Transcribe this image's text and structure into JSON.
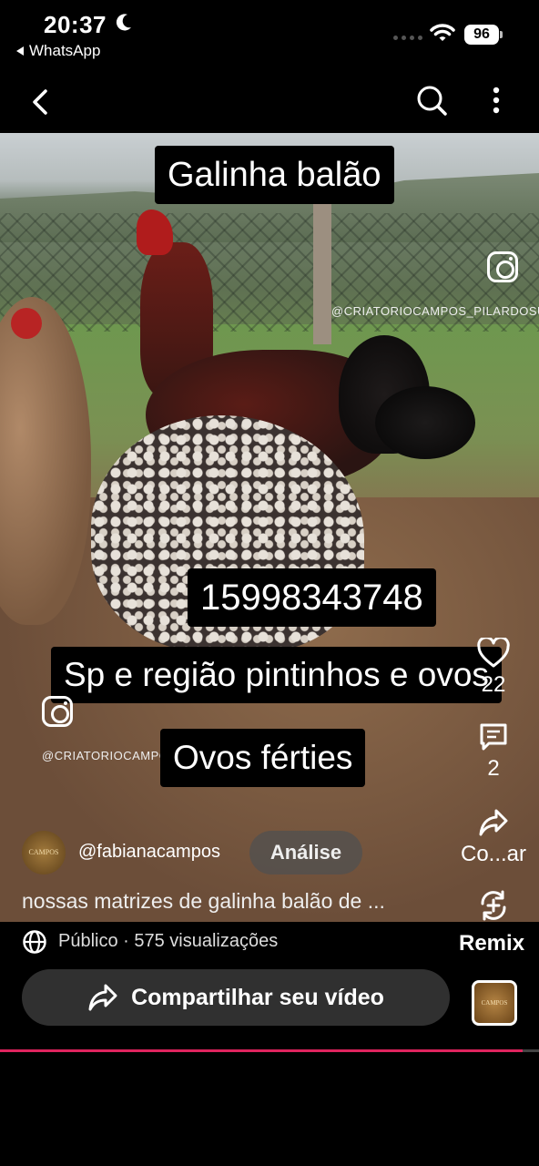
{
  "status_bar": {
    "time": "20:37",
    "back_app_label": "WhatsApp",
    "battery": "96",
    "icons": [
      "moon-icon",
      "signal-icon",
      "wifi-icon",
      "battery-icon"
    ]
  },
  "top_nav": {
    "icons": [
      "back-arrow-icon",
      "search-icon",
      "more-vertical-icon"
    ]
  },
  "video": {
    "overlays": {
      "title": "Galinha balão",
      "phone": "15998343748",
      "region": "Sp e região pintinhos e ovos",
      "eggs": "Ovos férties"
    },
    "watermark": "@CRIATORIOCAMPOS_PILARDOSUL",
    "watermark_2": "@CRIATORIOCAMPOS_PILARDOSUL",
    "progress_fraction": 0.97
  },
  "side_actions": {
    "likes": "22",
    "comments": "2",
    "share_label": "Co...ar",
    "icons": [
      "heart-icon",
      "comment-icon",
      "share-icon",
      "remix-icon"
    ]
  },
  "author": {
    "avatar_text": "CAMPOS",
    "username": "@fabianacampos",
    "analise_label": "Análise"
  },
  "caption": "nossas matrizes de galinha balão de ...",
  "info": {
    "visibility": "Público · 575 visualizações",
    "remix_label": "Remix"
  },
  "share": {
    "button_label": "Compartilhar seu vídeo",
    "thumb_text": "CAMPOS"
  },
  "colors": {
    "background": "#000000",
    "button_bg": "#303030",
    "progress": "#e0245e"
  }
}
